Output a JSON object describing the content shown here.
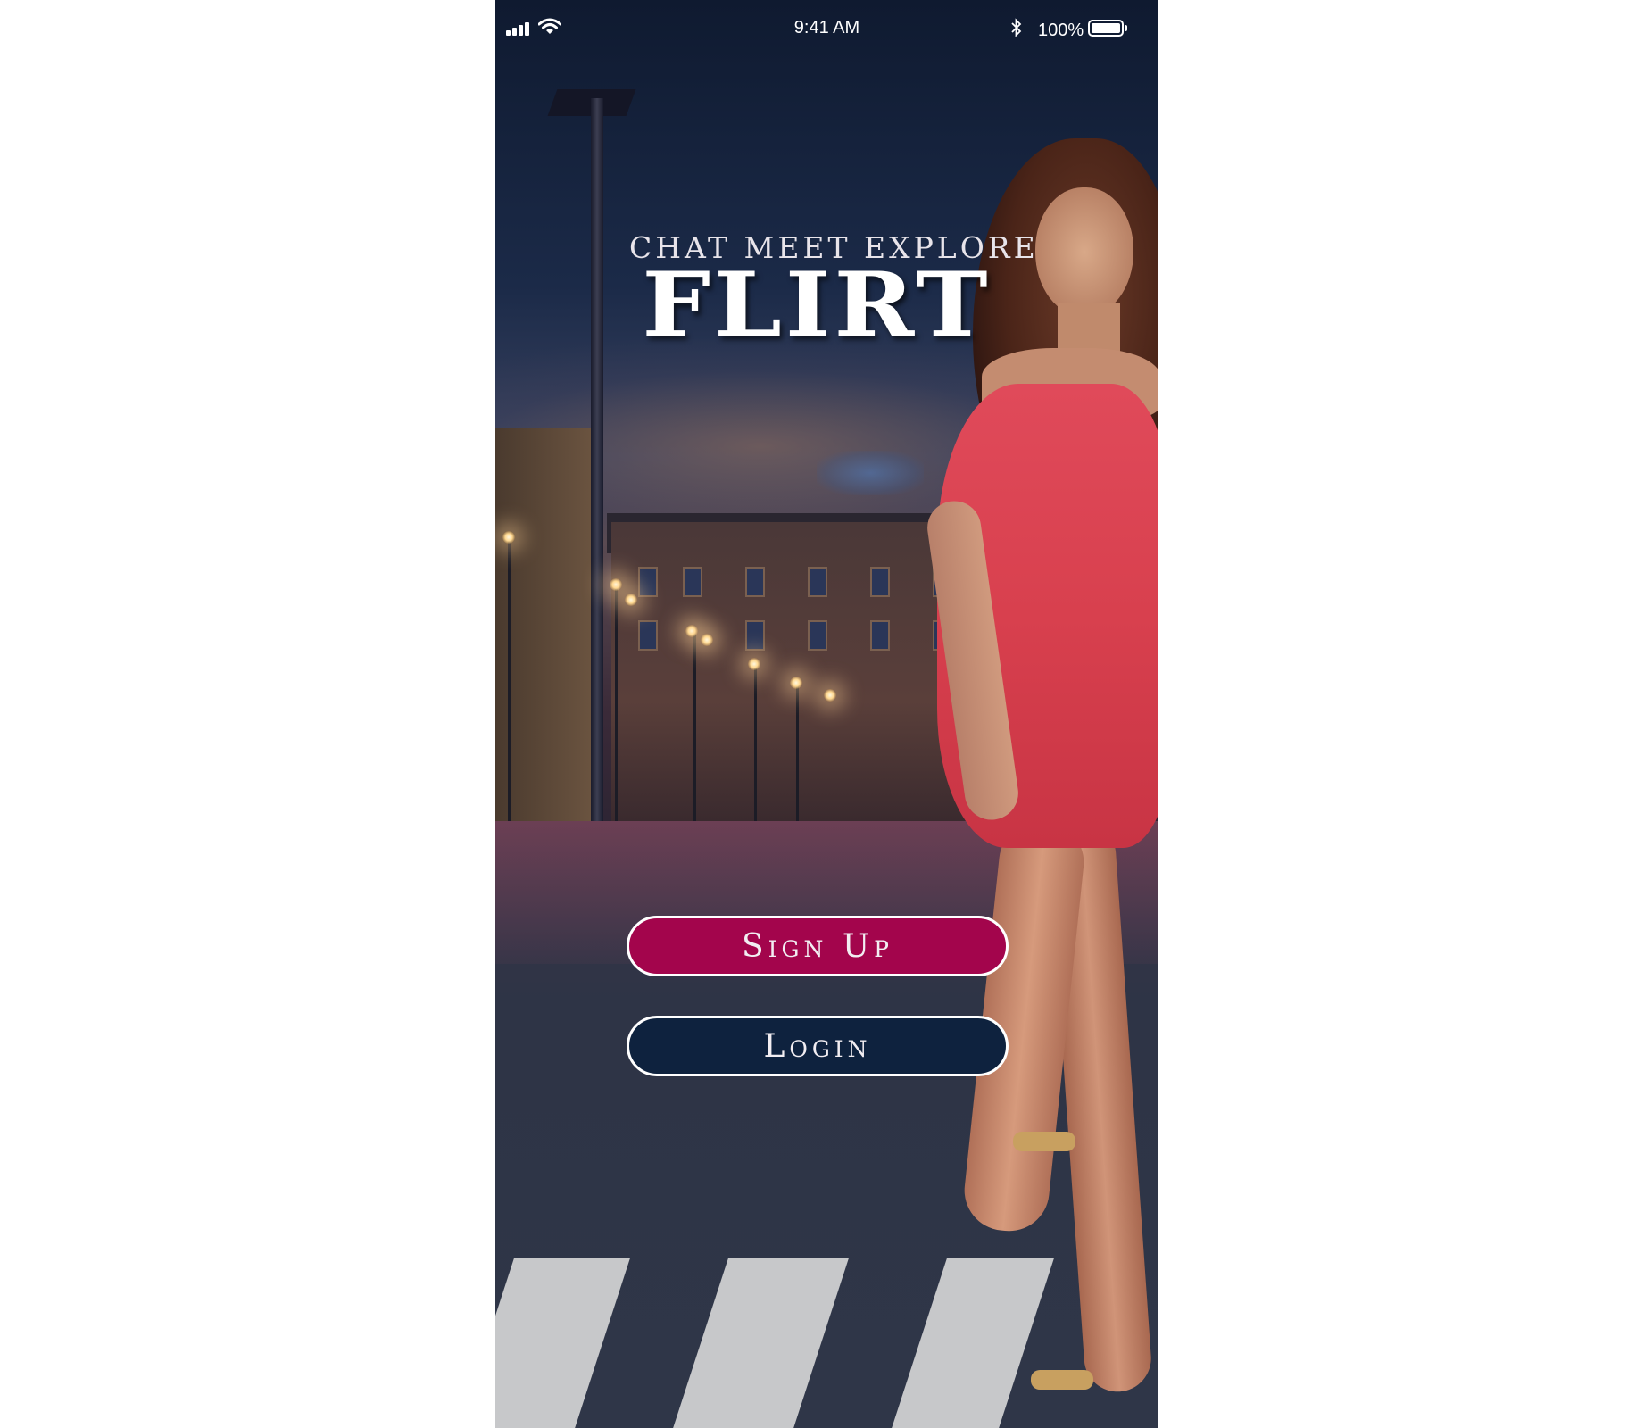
{
  "status_bar": {
    "time": "9:41 AM",
    "battery_percent": "100%",
    "battery_level": 1.0,
    "icons": [
      "signal-icon",
      "wifi-icon",
      "bluetooth-icon",
      "battery-icon"
    ]
  },
  "hero": {
    "tagline": "CHAT MEET EXPLORE",
    "title": "FLIRT"
  },
  "actions": {
    "signup_label": "Sign Up",
    "login_label": "Login"
  },
  "colors": {
    "signup_button": "#a3054c",
    "login_button": "#0e223e",
    "button_border": "#ffffff",
    "text": "#ffffff"
  }
}
